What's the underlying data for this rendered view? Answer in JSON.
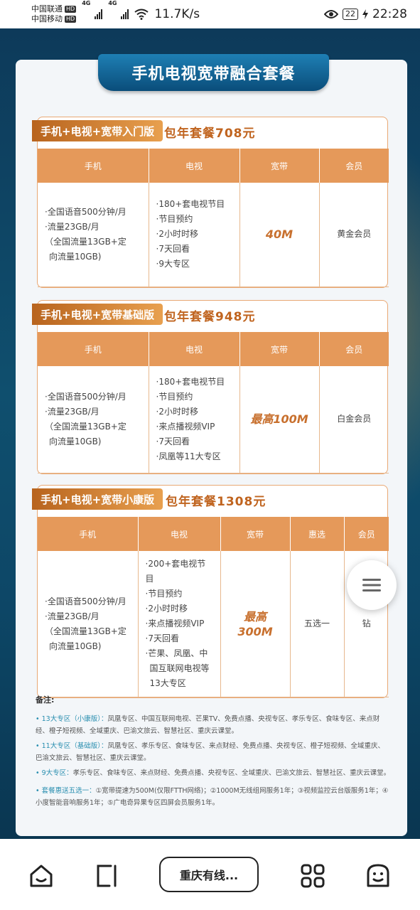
{
  "status_bar": {
    "carrier1": "中国联通",
    "carrier2": "中国移动",
    "hd": "HD",
    "signal_tag": "4G",
    "speed": "11.7K/s",
    "battery": "22",
    "time": "22:28"
  },
  "banner_title": "手机电视宽带融合套餐",
  "headers": {
    "phone": "手机",
    "tv": "电视",
    "broadband": "宽带",
    "member": "会员",
    "offer": "惠选"
  },
  "packages": [
    {
      "tag": "手机+电视+宽带入门版",
      "price": "包年套餐708元",
      "phone": [
        "·全国语音500分钟/月",
        "·流量23GB/月",
        "（全国流量13GB+定",
        "向流量10GB)"
      ],
      "tv": [
        "·180+套电视节目",
        "·节目预约",
        "·2小时时移",
        "·7天回看",
        "·9大专区"
      ],
      "broadband": "40M",
      "member": "黄金会员"
    },
    {
      "tag": "手机+电视+宽带基础版",
      "price": "包年套餐948元",
      "phone": [
        "·全国语音500分钟/月",
        "·流量23GB/月",
        "（全国流量13GB+定",
        "向流量10GB)"
      ],
      "tv": [
        "·180+套电视节目",
        "·节目预约",
        "·2小时时移",
        "·来点播视频VIP",
        "·7天回看",
        "·凤凰等11大专区"
      ],
      "broadband": "最高100M",
      "member": "白金会员"
    },
    {
      "tag": "手机+电视+宽带小康版",
      "price": "包年套餐1308元",
      "phone": [
        "·全国语音500分钟/月",
        "·流量23GB/月",
        "（全国流量13GB+定",
        "向流量10GB)"
      ],
      "tv": [
        "·200+套电视节目",
        "·节目预约",
        "·2小时时移",
        "·来点播视频VIP",
        "·7天回看",
        "·芒果、凤凰、中",
        "国互联网电视等",
        "13大专区"
      ],
      "broadband": "最高300M",
      "offer": "五选一",
      "member": "钻"
    }
  ],
  "notes": {
    "title": "备注:",
    "items": [
      {
        "key": "• 13大专区（小康版）：",
        "text": "凤凰专区、中国互联网电视、芒果TV、免费点播、央视专区、孝乐专区、食味专区、来点财经、橙子短视频、全域重庆、巴渝文旅云、智慧社区、重庆云课堂。"
      },
      {
        "key": "• 11大专区（基础版）：",
        "text": "凤凰专区、孝乐专区、食味专区、来点财经、免费点播、央视专区、橙子短视频、全域重庆、巴渝文旅云、智慧社区、重庆云课堂。"
      },
      {
        "key": "• 9大专区：",
        "text": "孝乐专区、食味专区、来点财经、免费点播、央视专区、全域重庆、巴渝文旅云、智慧社区、重庆云课堂。"
      },
      {
        "key": "• 套餐惠送五选一：",
        "text": "①宽带提速为500M(仅限FTTH网络)；②1000M无线组网服务1年；③视频监控云台版服务1年；④小度智能音响服务1年；⑤广电奇异果专区四屏会员服务1年。"
      }
    ]
  },
  "bottom_nav": {
    "address": "重庆有线..."
  },
  "colors": {
    "accent": "#e5995a",
    "price": "#c0641f",
    "banner": "#1e7fb4"
  }
}
